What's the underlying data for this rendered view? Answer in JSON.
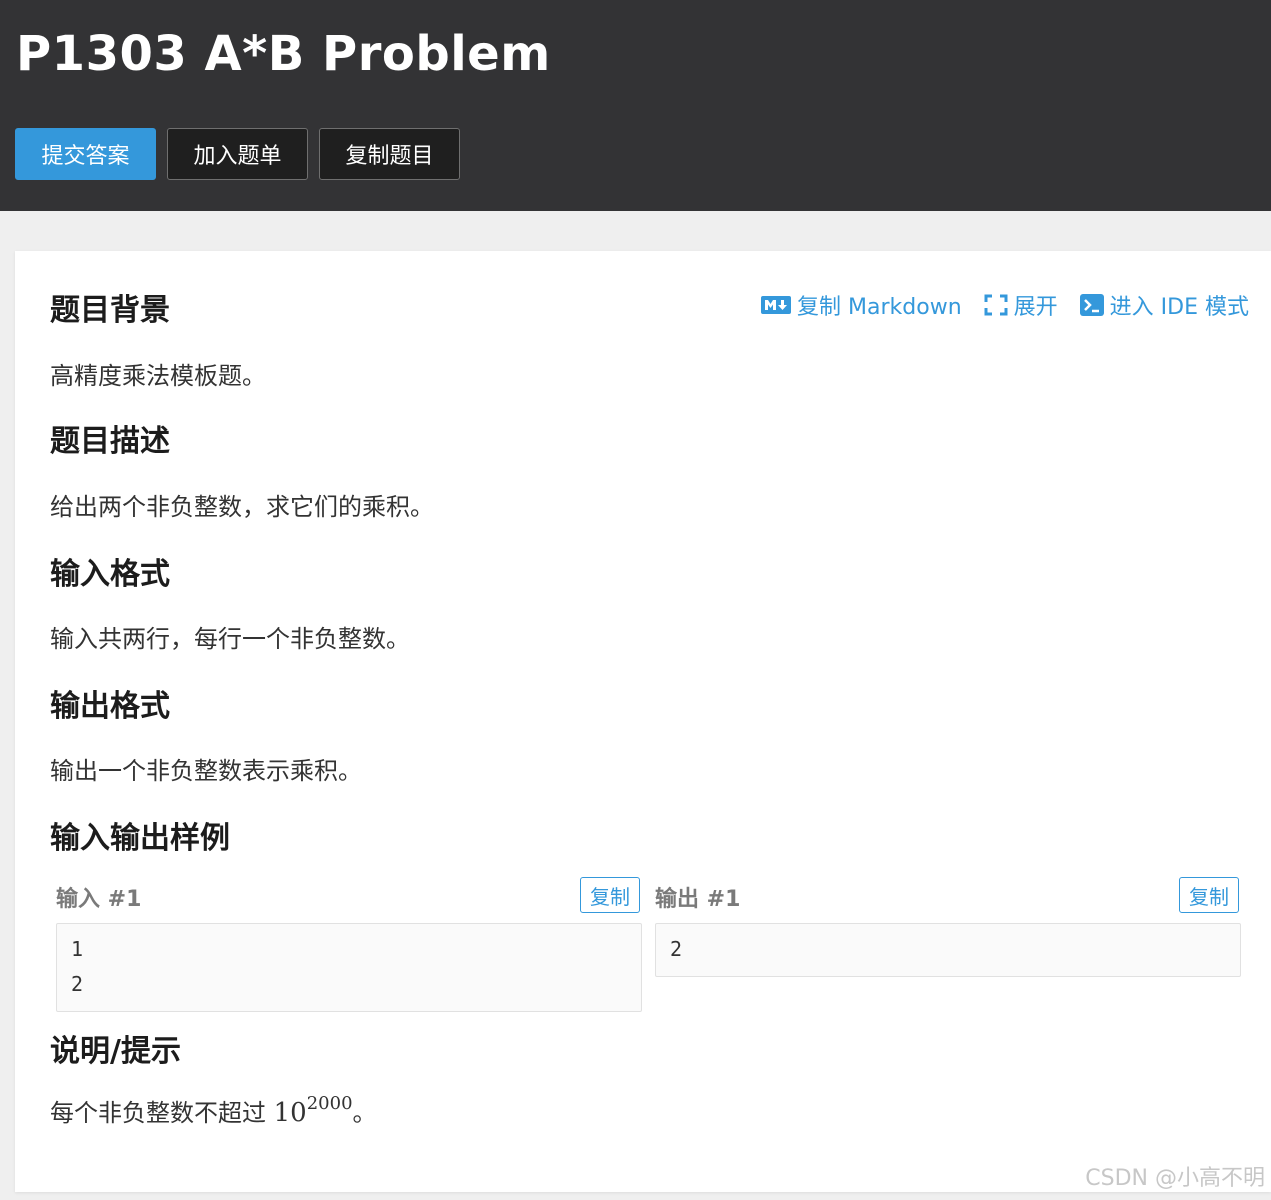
{
  "header": {
    "title": "P1303 A*B Problem",
    "buttons": {
      "submit": "提交答案",
      "add_to_list": "加入题单",
      "copy_problem": "复制题目"
    }
  },
  "toolbar": {
    "copy_markdown": "复制 Markdown",
    "expand": "展开",
    "ide_mode": "进入 IDE 模式"
  },
  "sections": {
    "background": {
      "heading": "题目背景",
      "text": "高精度乘法模板题。"
    },
    "description": {
      "heading": "题目描述",
      "text": "给出两个非负整数，求它们的乘积。"
    },
    "input_format": {
      "heading": "输入格式",
      "text": "输入共两行，每行一个非负整数。"
    },
    "output_format": {
      "heading": "输出格式",
      "text": "输出一个非负整数表示乘积。"
    },
    "samples": {
      "heading": "输入输出样例",
      "input_label": "输入 #1",
      "output_label": "输出 #1",
      "copy_label": "复制",
      "input_lines": [
        "1",
        "2"
      ],
      "output_lines": [
        "2"
      ]
    },
    "hint": {
      "heading": "说明/提示",
      "text_before": "每个非负整数不超过 ",
      "math_base": "10",
      "math_exp": "2000",
      "text_after": "。"
    }
  },
  "watermark": "CSDN @小高不明",
  "colors": {
    "header_bg": "#333335",
    "accent": "#3498db",
    "page_bg": "#efefef"
  }
}
